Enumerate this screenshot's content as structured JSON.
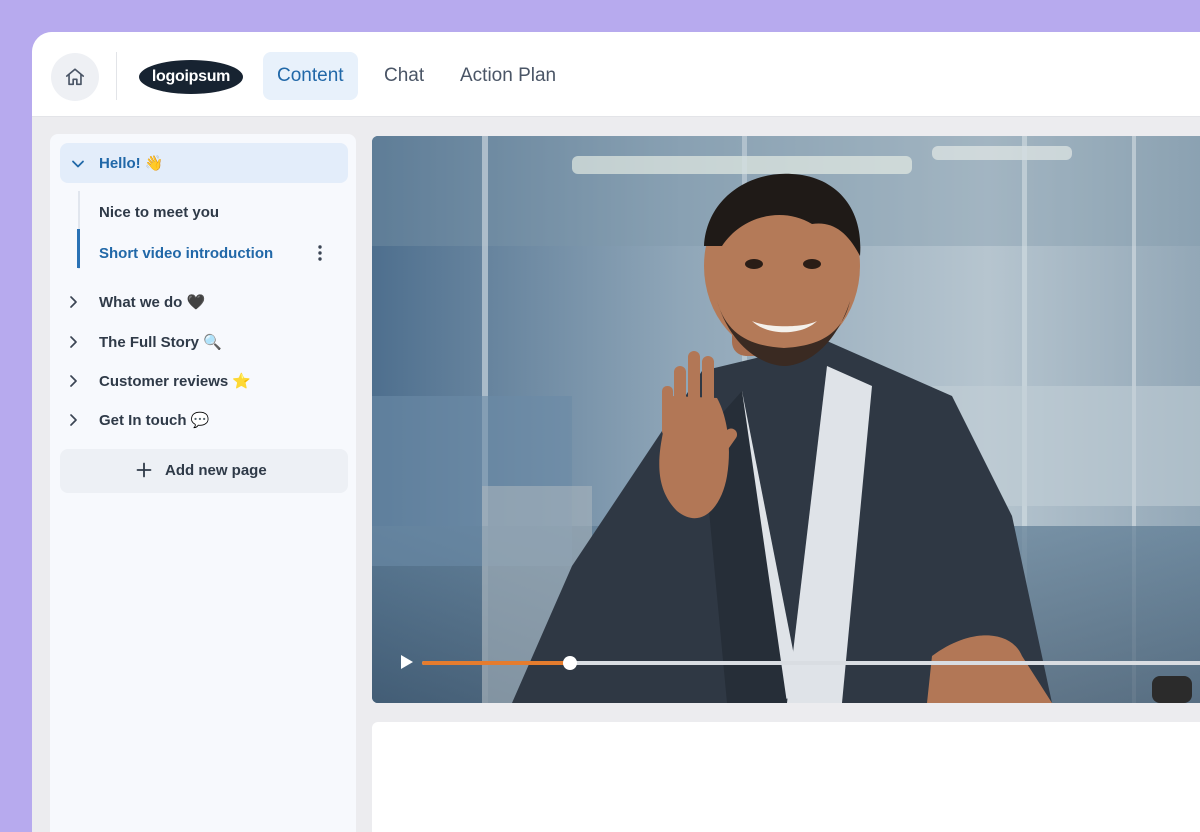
{
  "topbar": {
    "logo_text": "logoipsum",
    "tabs": [
      {
        "label": "Content",
        "active": true
      },
      {
        "label": "Chat",
        "active": false
      },
      {
        "label": "Action Plan",
        "active": false
      }
    ]
  },
  "sidebar": {
    "section": {
      "label": "Hello! 👋",
      "expanded": true
    },
    "subitems": [
      {
        "label": "Nice to meet you",
        "active": false
      },
      {
        "label": "Short video introduction",
        "active": true
      }
    ],
    "items": [
      {
        "label": "What we do 🖤"
      },
      {
        "label": "The Full Story 🔍"
      },
      {
        "label": "Customer reviews ⭐"
      },
      {
        "label": "Get In touch 💬"
      }
    ],
    "add_page_label": "Add new page"
  },
  "video": {
    "progress": 0.185,
    "content": "man in suit waving at camera in office"
  },
  "colors": {
    "accent": "#2168a8",
    "progress": "#e57c2e",
    "frame": "#b7aaee"
  }
}
